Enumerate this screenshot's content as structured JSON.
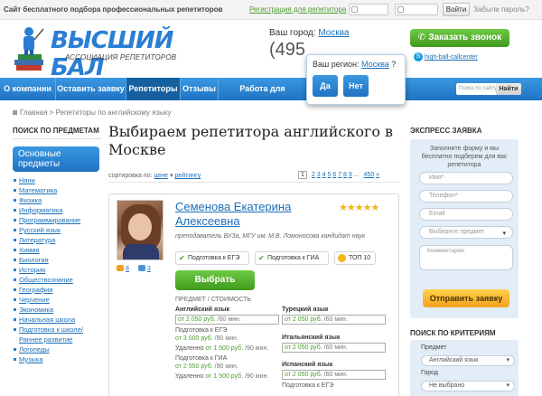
{
  "topbar": {
    "slogan": "Сайт бесплатного подбора профессиональных репетиторов",
    "register_link": "Регистрация для репетитора",
    "enter_label": "Войти",
    "forgot_label": "Забыли пароль?"
  },
  "header": {
    "logo_title": "ВЫСШИЙ БАЛ",
    "logo_subtitle": "АССОЦИАЦИЯ РЕПЕТИТОРОВ",
    "city_label": "Ваш город:",
    "city_value": "Москва",
    "phone": "(495",
    "call_button": "Заказать звонок",
    "skype_link": "high-ball-callcenter"
  },
  "nav": {
    "items": [
      "О компании",
      "Оставить заявку",
      "Репетиторы",
      "Отзывы",
      "Работа для репетитора"
    ],
    "active_index": 2,
    "search_placeholder": "Поиск по сайту",
    "search_button": "Найти"
  },
  "region_popup": {
    "question_prefix": "Ваш регион:",
    "region": "Москва",
    "question_suffix": "?",
    "yes_label": "Да",
    "no_label": "Нет"
  },
  "breadcrumb": {
    "home": "Главная",
    "separator": " > ",
    "current": "Репетиторы по английскому языку"
  },
  "left_sidebar": {
    "heading": "ПОИСК ПО ПРЕДМЕТАМ",
    "primary_button": "Основные предметы",
    "subjects": [
      "Няни",
      "Математика",
      "Физика",
      "Информатика",
      "Программирование",
      "Русский язык",
      "Литература",
      "Химия",
      "Биология",
      "История",
      "Обществознание",
      "География",
      "Черчение",
      "Экономика",
      "Начальная школа",
      "Подготовка к школе/ Раннее развитие",
      "Логопеды",
      "Музыка"
    ]
  },
  "main": {
    "heading": "Выбираем репетитора английского в Москве",
    "sort_label": "сортировка по:",
    "sort_price": "цене",
    "sort_rating": "рейтингу",
    "sort_arrow": "▾",
    "pages": [
      "1",
      "2",
      "3",
      "4",
      "5",
      "6",
      "7",
      "8",
      "9",
      "...",
      "450",
      "»"
    ],
    "current_page": "1"
  },
  "tutor": {
    "name": "Семенова Екатерина Алексеевна",
    "stars": "★★★★★",
    "description": "преподаватель ВУЗа, МГУ им. М.В. Ломоносова кандидат наук",
    "reviews_count": "8",
    "comments_count": "3",
    "badges": [
      "Подготовка к ЕГЭ",
      "Подготовка к ГИА",
      "ТОП 10"
    ],
    "choose_button": "Выбрать",
    "price_heading": "ПРЕДМЕТ / СТОИМОСТЬ",
    "subjects": [
      {
        "title": "Английский язык",
        "price": "от 2 050 руб.",
        "unit": "/60 мин.",
        "extras": [
          {
            "label": "Подготовка к ЕГЭ",
            "price": "от 3 000 руб.",
            "unit": "/90 мин."
          },
          {
            "label": "Удаленно",
            "price": "от 1 500 руб.",
            "unit": "/90 мин."
          },
          {
            "label": "Подготовка к ГИА",
            "price": "от 2 550 руб.",
            "unit": "/90 мин."
          },
          {
            "label": "Удаленно",
            "price": "от 1 500 руб.",
            "unit": "/90 мин."
          }
        ]
      },
      {
        "title": "Турецкий язык",
        "price": "от 2 050 руб.",
        "unit": "/60 мин."
      },
      {
        "title": "Итальянский язык",
        "price": "от 2 050 руб.",
        "unit": "/60 мин."
      },
      {
        "title": "Испанский язык",
        "price": "от 2 050 руб.",
        "unit": "/60 мин.",
        "extras": [
          {
            "label": "Подготовка к ЕГЭ",
            "price": "",
            "unit": ""
          }
        ]
      }
    ]
  },
  "express": {
    "heading": "ЭКСПРЕСС ЗАЯВКА",
    "intro": "Заполните форму и мы бесплатно подберем для вас репетитора",
    "name_placeholder": "Имя*",
    "phone_placeholder": "Телефон*",
    "email_placeholder": "Email",
    "subject_placeholder": "Выберите предмет",
    "comment_placeholder": "Комментарии",
    "send_button": "Отправить заявку"
  },
  "criteria": {
    "heading": "ПОИСК ПО КРИТЕРИЯМ",
    "subject_label": "Предмет",
    "subject_value": "Английский язык",
    "city_label": "Город",
    "city_value": "Не выбрано"
  }
}
